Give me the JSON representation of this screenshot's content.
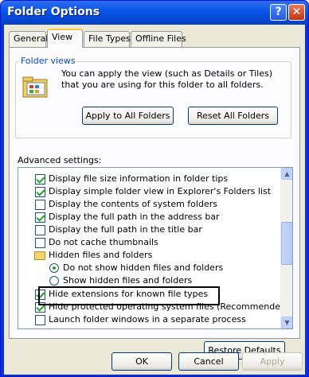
{
  "window": {
    "title": "Folder Options",
    "help_glyph": "?",
    "close_glyph": "✕"
  },
  "tabs": [
    {
      "label": "General",
      "active": false
    },
    {
      "label": "View",
      "active": true
    },
    {
      "label": "File Types",
      "active": false
    },
    {
      "label": "Offline Files",
      "active": false
    }
  ],
  "folder_views": {
    "legend": "Folder views",
    "description": "You can apply the view (such as Details or Tiles) that you are using for this folder to all folders.",
    "apply_button": "Apply to All Folders",
    "reset_button": "Reset All Folders"
  },
  "advanced": {
    "label": "Advanced settings:",
    "items": [
      {
        "type": "checkbox",
        "checked": true,
        "label": "Display file size information in folder tips",
        "indent": 1
      },
      {
        "type": "checkbox",
        "checked": true,
        "label": "Display simple folder view in Explorer's Folders list",
        "indent": 1
      },
      {
        "type": "checkbox",
        "checked": false,
        "label": "Display the contents of system folders",
        "indent": 1
      },
      {
        "type": "checkbox",
        "checked": true,
        "label": "Display the full path in the address bar",
        "indent": 1
      },
      {
        "type": "checkbox",
        "checked": false,
        "label": "Display the full path in the title bar",
        "indent": 1
      },
      {
        "type": "checkbox",
        "checked": false,
        "label": "Do not cache thumbnails",
        "indent": 1
      },
      {
        "type": "folder",
        "checked": false,
        "label": "Hidden files and folders",
        "indent": 1
      },
      {
        "type": "radio",
        "checked": true,
        "label": "Do not show hidden files and folders",
        "indent": 2
      },
      {
        "type": "radio",
        "checked": false,
        "label": "Show hidden files and folders",
        "indent": 2
      },
      {
        "type": "checkbox",
        "checked": true,
        "label": "Hide extensions for known file types",
        "indent": 1
      },
      {
        "type": "checkbox",
        "checked": true,
        "label": "Hide protected operating system files (Recommended)",
        "indent": 1
      },
      {
        "type": "checkbox",
        "checked": false,
        "label": "Launch folder windows in a separate process",
        "indent": 1
      }
    ],
    "scroll_up_glyph": "▲",
    "scroll_down_glyph": "▼"
  },
  "restore_button": "Restore Defaults",
  "footer": {
    "ok": "OK",
    "cancel": "Cancel",
    "apply": "Apply"
  }
}
